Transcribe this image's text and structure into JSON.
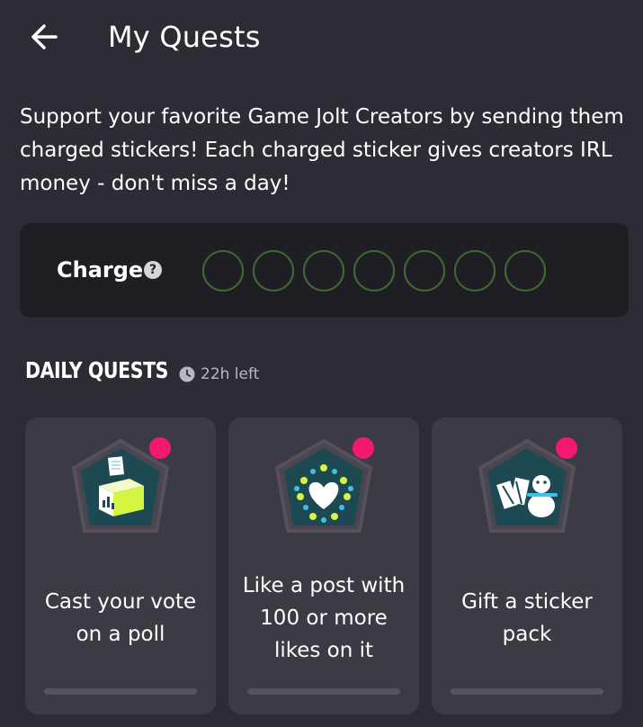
{
  "header": {
    "title": "My Quests",
    "back_icon": "arrow-left-icon"
  },
  "intro": {
    "text": "Support your favorite Game Jolt Creators by sending them charged stickers! Each charged sticker gives creators IRL money - don't miss a day!"
  },
  "charge": {
    "label": "Charge",
    "help_icon": "?",
    "orbs_total": 7,
    "orbs_filled": 0,
    "orb_color": "#3f6b2f"
  },
  "daily_quests": {
    "title": "DAILY QUESTS",
    "time_left": "22h left",
    "clock_icon": "clock-icon",
    "items": [
      {
        "text": "Cast your vote on a poll",
        "icon": "ballot-box-icon",
        "progress": 0,
        "new_dot_color": "#f2196e"
      },
      {
        "text": "Like a post with 100 or more likes on it",
        "icon": "hearts-icon",
        "progress": 0,
        "new_dot_color": "#f2196e"
      },
      {
        "text": "Gift a sticker pack",
        "icon": "gift-snowman-icon",
        "progress": 0,
        "new_dot_color": "#f2196e"
      }
    ]
  },
  "colors": {
    "background": "#2d2b33",
    "panel": "#1f1e24",
    "card": "#3c3a42",
    "accent_green": "#b9f522",
    "accent_pink": "#f2196e",
    "badge_teal": "#1d4a52"
  }
}
